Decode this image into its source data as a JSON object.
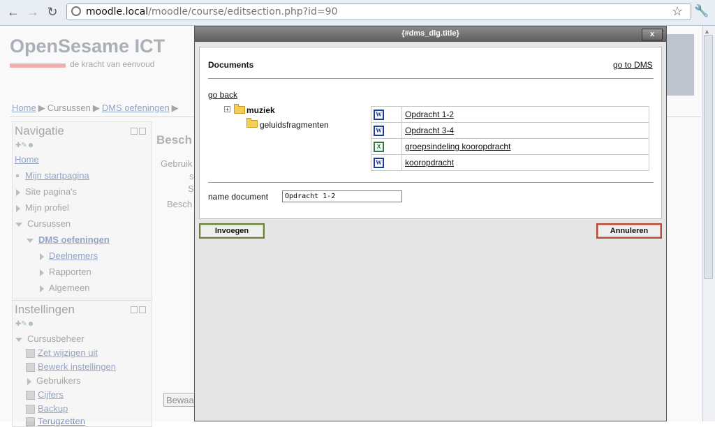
{
  "browser": {
    "url_host": "moodle.local",
    "url_path": "/moodle/course/editsection.php?id=90"
  },
  "site": {
    "title": "OpenSesame ICT",
    "tagline": "de kracht van eenvoud"
  },
  "breadcrumb": {
    "items": [
      "Home",
      "Cursussen",
      "DMS oefeningen"
    ]
  },
  "navigation": {
    "title": "Navigatie",
    "items": [
      "Home",
      "Mijn startpagina",
      "Site pagina's",
      "Mijn profiel",
      "Cursussen",
      "DMS oefeningen",
      "Deelnemers",
      "Rapporten",
      "Algemeen"
    ]
  },
  "settings": {
    "title": "Instellingen",
    "items": [
      "Cursusbeheer",
      "Zet wijzigen uit",
      "Bewerk instellingen",
      "Gebruikers",
      "Cijfers",
      "Backup",
      "Terugzetten"
    ]
  },
  "content": {
    "heading": "Besch",
    "frag1": "Gebruik",
    "frag2": "s",
    "frag3": "S",
    "frag4": "Besch",
    "save_button": "Bewaa"
  },
  "dialog": {
    "title": "{#dms_dlg.title}",
    "close": "x",
    "heading": "Documents",
    "go_to_dms": "go to DMS",
    "go_back": "go back",
    "tree": {
      "root": "muziek",
      "child": "geluidsfragmenten"
    },
    "documents": [
      {
        "name": "Opdracht 1-2",
        "type": "word-icon"
      },
      {
        "name": "Opdracht 3-4",
        "type": "word-icon"
      },
      {
        "name": "groepsindeling kooropdracht",
        "type": "excel-icon"
      },
      {
        "name": "kooropdracht",
        "type": "word-icon"
      }
    ],
    "name_label": "name document",
    "name_value": "Opdracht 1-2",
    "insert_button": "Invoegen",
    "cancel_button": "Annuleren"
  }
}
